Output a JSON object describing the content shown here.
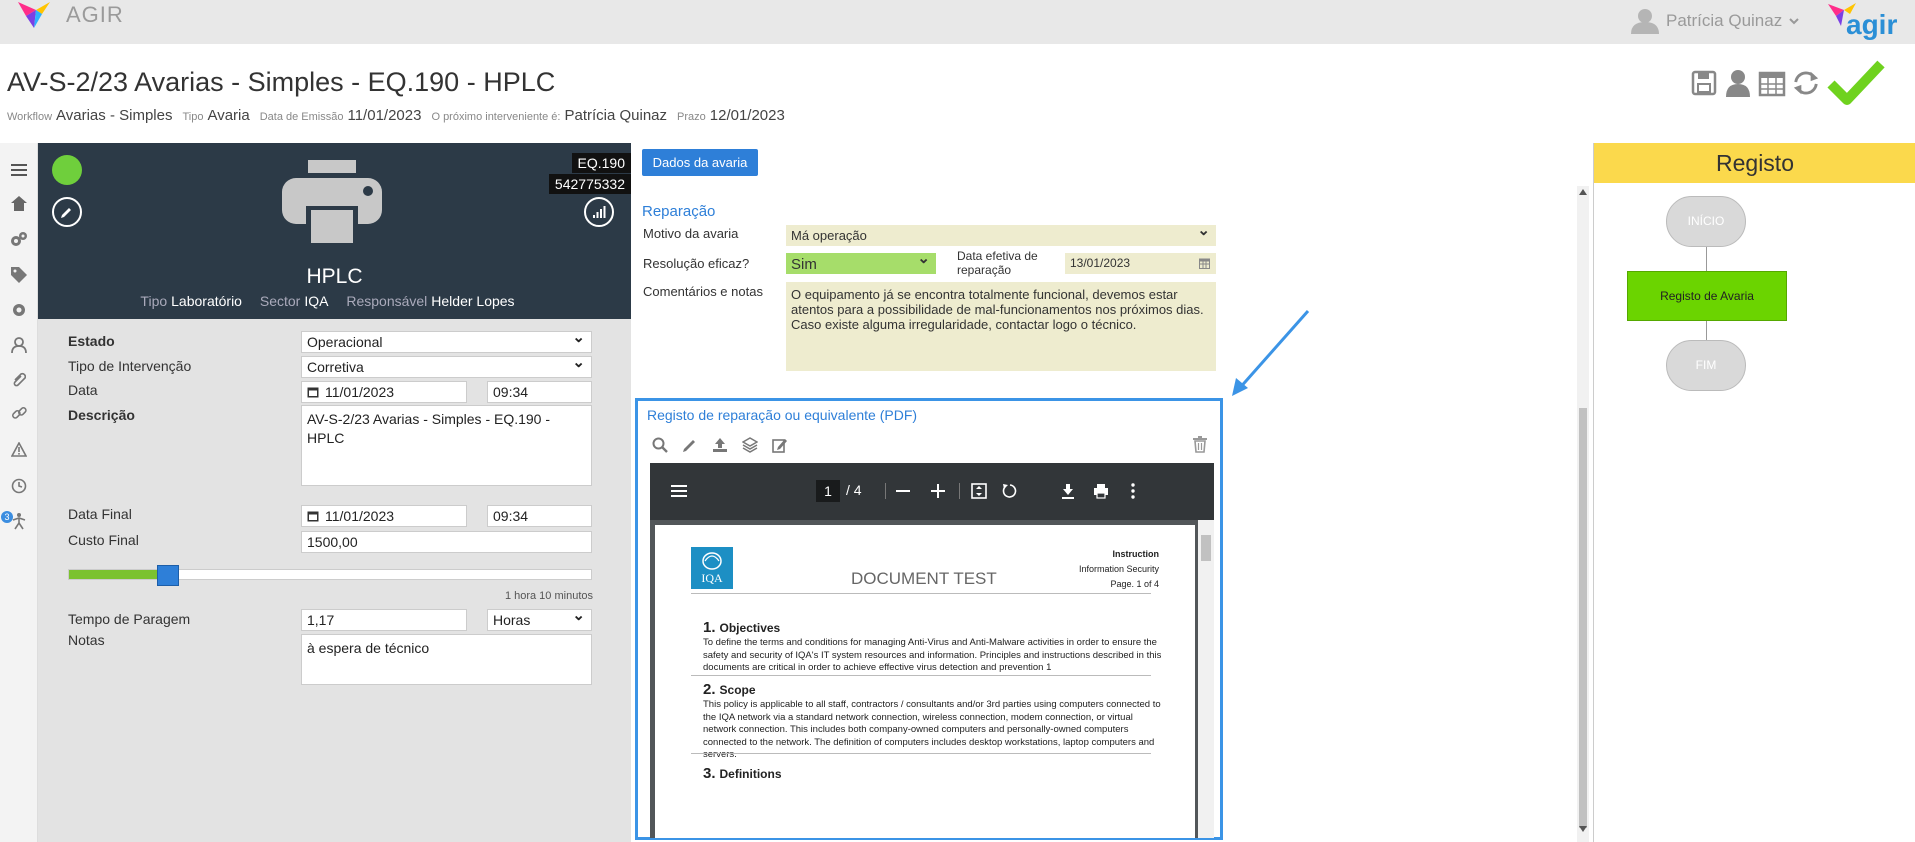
{
  "app": {
    "name": "AGIR",
    "brand": "agir",
    "user_name": "Patrícia Quinaz"
  },
  "header": {
    "title": "AV-S-2/23 Avarias - Simples - EQ.190 - HPLC",
    "meta": [
      {
        "label": "Workflow",
        "value": "Avarias - Simples"
      },
      {
        "label": "Tipo",
        "value": "Avaria"
      },
      {
        "label": "Data de Emissão",
        "value": "11/01/2023"
      },
      {
        "label": "O próximo interveniente é:",
        "value": "Patrícia Quinaz"
      },
      {
        "label": "Prazo",
        "value": "12/01/2023"
      }
    ]
  },
  "rail": {
    "badge_count": "3"
  },
  "equipment": {
    "code": "EQ.190",
    "serial": "542775332",
    "name": "HPLC",
    "tipo_label": "Tipo",
    "tipo": "Laboratório",
    "sector_label": "Sector",
    "sector": "IQA",
    "responsavel_label": "Responsável",
    "responsavel": "Helder Lopes",
    "status_color": "#6fcf3c"
  },
  "form": {
    "estado_label": "Estado",
    "estado": "Operacional",
    "tipo_intervencao_label": "Tipo de Intervenção",
    "tipo_intervencao": "Corretiva",
    "data_label": "Data",
    "data_date": "11/01/2023",
    "data_time": "09:34",
    "descricao_label": "Descrição",
    "descricao": "AV-S-2/23 Avarias - Simples - EQ.190 - HPLC",
    "data_final_label": "Data Final",
    "data_final_date": "11/01/2023",
    "data_final_time": "09:34",
    "custo_final_label": "Custo Final",
    "custo_final": "1500,00",
    "slider_fraction": 0.19,
    "slider_caption": "1 hora 10 minutos",
    "tempo_paragem_label": "Tempo de Paragem",
    "tempo_paragem": "1,17",
    "tempo_unit": "Horas",
    "notas_label": "Notas",
    "notas": "à espera de técnico"
  },
  "middle": {
    "tab_label": "Dados da avaria",
    "section_title": "Reparação",
    "motivo_label": "Motivo da avaria",
    "motivo": "Má operação",
    "resolucao_label": "Resolução eficaz?",
    "resolucao": "Sim",
    "data_efetiva_label": "Data efetiva de reparação",
    "data_efetiva": "13/01/2023",
    "comentarios_label": "Comentários e notas",
    "comentarios": "O equipamento já se encontra totalmente funcional, devemos estar atentos para a possibilidade de mal-funcionamentos nos próximos dias. Caso existe alguma irregularidade, contactar logo o técnico."
  },
  "pdf": {
    "title": "Registo de reparação ou equivalente (PDF)",
    "current_page": "1",
    "page_total": "/ 4",
    "doc": {
      "logo_text": "IQA",
      "title": "DOCUMENT TEST",
      "head_lines": [
        "Instruction",
        "Information Security",
        "Page. 1 of 4"
      ],
      "sections": [
        {
          "num": "1.",
          "title": "Objectives",
          "text": "To define the terms and conditions for managing Anti-Virus and Anti-Malware activities in order to ensure the safety and security of IQA's IT system resources and information. Principles and instructions described in this documents are critical in order to achieve effective virus detection and prevention 1"
        },
        {
          "num": "2.",
          "title": "Scope",
          "text": "This policy is applicable to all staff, contractors / consultants and/or 3rd parties using computers connected to the IQA network via a standard network connection, wireless connection, modem connection, or virtual network connection. This includes both company-owned computers and personally-owned computers connected to the network. The definition of computers includes desktop workstations, laptop computers and servers."
        },
        {
          "num": "3.",
          "title": "Definitions",
          "text": ""
        }
      ]
    }
  },
  "flow": {
    "title": "Registo",
    "start": "INÍCIO",
    "step": "Registo de Avaria",
    "end": "FIM",
    "header_color": "#fbd94c",
    "active_color": "#6bd400"
  },
  "colors": {
    "accent": "#2e7fd8",
    "ok": "#6fcf3c"
  }
}
